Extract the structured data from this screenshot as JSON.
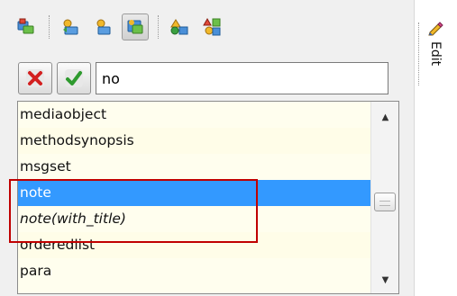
{
  "toolbar": {
    "buttons": [
      {
        "icon": "insert-element-icon",
        "active": false
      },
      {
        "icon": "insert-before-icon",
        "active": false
      },
      {
        "icon": "insert-after-icon",
        "active": false
      },
      {
        "icon": "append-child-icon",
        "active": true
      },
      {
        "icon": "convert-element-icon",
        "active": false
      },
      {
        "icon": "replace-element-icon",
        "active": false
      }
    ]
  },
  "search": {
    "value": "no",
    "cancel_icon": "close-icon",
    "accept_icon": "checkmark-icon"
  },
  "list": {
    "items": [
      {
        "label": "mediaobject",
        "selected": false,
        "italic": false
      },
      {
        "label": "methodsynopsis",
        "selected": false,
        "italic": false
      },
      {
        "label": "msgset",
        "selected": false,
        "italic": false
      },
      {
        "label": "note",
        "selected": true,
        "italic": false
      },
      {
        "label": "note(with_title)",
        "selected": false,
        "italic": true
      },
      {
        "label": "orderedlist",
        "selected": false,
        "italic": false
      },
      {
        "label": "para",
        "selected": false,
        "italic": false
      }
    ]
  },
  "side_tab": {
    "label": "Edit",
    "icon": "pencil-icon"
  },
  "colors": {
    "selection": "#3399ff",
    "highlight_box": "#c00000",
    "list_background": "#fffeee"
  }
}
